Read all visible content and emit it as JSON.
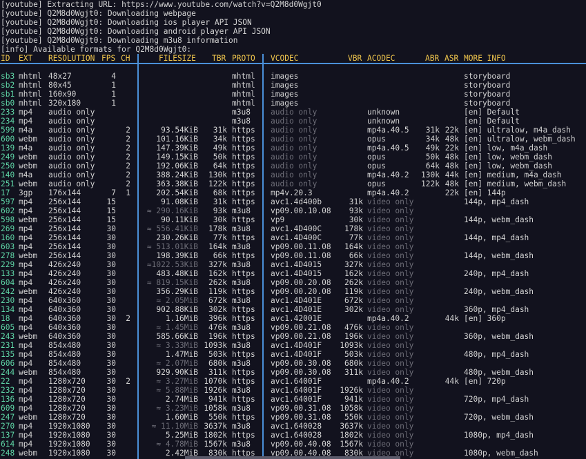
{
  "log_lines": [
    "[youtube] Extracting URL: https://www.youtube.com/watch?v=Q2M8d0Wgjt0",
    "[youtube] Q2M8d0Wgjt0: Downloading webpage",
    "[youtube] Q2M8d0Wgjt0: Downloading ios player API JSON",
    "[youtube] Q2M8d0Wgjt0: Downloading android player API JSON",
    "[youtube] Q2M8d0Wgjt0: Downloading m3u8 information",
    "[info] Available formats for Q2M8d0Wgjt0:"
  ],
  "header": {
    "id": "ID",
    "ext": "EXT",
    "res": "RESOLUTION",
    "fps": "FPS",
    "ch": "CH",
    "sep1": "│",
    "filesize": "FILESIZE",
    "tbr": "TBR",
    "proto": "PROTO",
    "sep2": "│",
    "vcodec": "VCODEC",
    "vbr": "VBR",
    "acodec": "ACODEC",
    "abr": "ABR",
    "asr": "ASR",
    "info": "MORE INFO"
  },
  "rows": [
    {
      "id": "sb3",
      "ext": "mhtml",
      "res": "48x27",
      "fps": "4",
      "ch": "",
      "fs": "",
      "tbr": "",
      "proto": "mhtml",
      "vc": "images",
      "vbr": "",
      "ac": "",
      "abr": "",
      "asr": "",
      "info": "storyboard"
    },
    {
      "id": "sb2",
      "ext": "mhtml",
      "res": "80x45",
      "fps": "1",
      "ch": "",
      "fs": "",
      "tbr": "",
      "proto": "mhtml",
      "vc": "images",
      "vbr": "",
      "ac": "",
      "abr": "",
      "asr": "",
      "info": "storyboard"
    },
    {
      "id": "sb1",
      "ext": "mhtml",
      "res": "160x90",
      "fps": "1",
      "ch": "",
      "fs": "",
      "tbr": "",
      "proto": "mhtml",
      "vc": "images",
      "vbr": "",
      "ac": "",
      "abr": "",
      "asr": "",
      "info": "storyboard"
    },
    {
      "id": "sb0",
      "ext": "mhtml",
      "res": "320x180",
      "fps": "1",
      "ch": "",
      "fs": "",
      "tbr": "",
      "proto": "mhtml",
      "vc": "images",
      "vbr": "",
      "ac": "",
      "abr": "",
      "asr": "",
      "info": "storyboard"
    },
    {
      "id": "233",
      "ext": "mp4",
      "res": "audio only",
      "fps": "",
      "ch": "",
      "fs": "",
      "tbr": "",
      "proto": "m3u8",
      "vc": "audio only",
      "vbr": "",
      "ac": "unknown",
      "abr": "",
      "asr": "",
      "info": "[en] Default"
    },
    {
      "id": "234",
      "ext": "mp4",
      "res": "audio only",
      "fps": "",
      "ch": "",
      "fs": "",
      "tbr": "",
      "proto": "m3u8",
      "vc": "audio only",
      "vbr": "",
      "ac": "unknown",
      "abr": "",
      "asr": "",
      "info": "[en] Default"
    },
    {
      "id": "599",
      "ext": "m4a",
      "res": "audio only",
      "fps": "",
      "ch": "2",
      "fs": "93.54KiB",
      "tbr": "31k",
      "proto": "https",
      "vc": "audio only",
      "vbr": "",
      "ac": "mp4a.40.5",
      "abr": "31k",
      "asr": "22k",
      "info": "[en] ultralow, m4a_dash"
    },
    {
      "id": "600",
      "ext": "webm",
      "res": "audio only",
      "fps": "",
      "ch": "2",
      "fs": "101.16KiB",
      "tbr": "34k",
      "proto": "https",
      "vc": "audio only",
      "vbr": "",
      "ac": "opus",
      "abr": "34k",
      "asr": "48k",
      "info": "[en] ultralow, webm_dash"
    },
    {
      "id": "139",
      "ext": "m4a",
      "res": "audio only",
      "fps": "",
      "ch": "2",
      "fs": "147.39KiB",
      "tbr": "49k",
      "proto": "https",
      "vc": "audio only",
      "vbr": "",
      "ac": "mp4a.40.5",
      "abr": "49k",
      "asr": "22k",
      "info": "[en] low, m4a_dash"
    },
    {
      "id": "249",
      "ext": "webm",
      "res": "audio only",
      "fps": "",
      "ch": "2",
      "fs": "149.15KiB",
      "tbr": "50k",
      "proto": "https",
      "vc": "audio only",
      "vbr": "",
      "ac": "opus",
      "abr": "50k",
      "asr": "48k",
      "info": "[en] low, webm_dash"
    },
    {
      "id": "250",
      "ext": "webm",
      "res": "audio only",
      "fps": "",
      "ch": "2",
      "fs": "192.06KiB",
      "tbr": "64k",
      "proto": "https",
      "vc": "audio only",
      "vbr": "",
      "ac": "opus",
      "abr": "64k",
      "asr": "48k",
      "info": "[en] low, webm_dash"
    },
    {
      "id": "140",
      "ext": "m4a",
      "res": "audio only",
      "fps": "",
      "ch": "2",
      "fs": "388.24KiB",
      "tbr": "130k",
      "proto": "https",
      "vc": "audio only",
      "vbr": "",
      "ac": "mp4a.40.2",
      "abr": "130k",
      "asr": "44k",
      "info": "[en] medium, m4a_dash"
    },
    {
      "id": "251",
      "ext": "webm",
      "res": "audio only",
      "fps": "",
      "ch": "2",
      "fs": "363.38KiB",
      "tbr": "122k",
      "proto": "https",
      "vc": "audio only",
      "vbr": "",
      "ac": "opus",
      "abr": "122k",
      "asr": "48k",
      "info": "[en] medium, webm_dash"
    },
    {
      "id": "17",
      "ext": "3gp",
      "res": "176x144",
      "fps": "7",
      "ch": "1",
      "fs": "202.54KiB",
      "tbr": "68k",
      "proto": "https",
      "vc": "mp4v.20.3",
      "vbr": "",
      "ac": "mp4a.40.2",
      "abr": "",
      "asr": "22k",
      "info": "[en] 144p"
    },
    {
      "id": "597",
      "ext": "mp4",
      "res": "256x144",
      "fps": "15",
      "ch": "",
      "fs": "91.08KiB",
      "tbr": "31k",
      "proto": "https",
      "vc": "avc1.4d400b",
      "vbr": "31k",
      "ac": "video only",
      "abr": "",
      "asr": "",
      "info": "144p, mp4_dash"
    },
    {
      "id": "602",
      "ext": "mp4",
      "res": "256x144",
      "fps": "15",
      "ch": "",
      "fs": "≈ 290.16KiB",
      "tbr": "93k",
      "proto": "m3u8",
      "vc": "vp09.00.10.08",
      "vbr": "93k",
      "ac": "video only",
      "abr": "",
      "asr": "",
      "info": ""
    },
    {
      "id": "598",
      "ext": "webm",
      "res": "256x144",
      "fps": "15",
      "ch": "",
      "fs": "90.11KiB",
      "tbr": "30k",
      "proto": "https",
      "vc": "vp9",
      "vbr": "30k",
      "ac": "video only",
      "abr": "",
      "asr": "",
      "info": "144p, webm_dash"
    },
    {
      "id": "269",
      "ext": "mp4",
      "res": "256x144",
      "fps": "30",
      "ch": "",
      "fs": "≈ 556.41KiB",
      "tbr": "178k",
      "proto": "m3u8",
      "vc": "avc1.4D400C",
      "vbr": "178k",
      "ac": "video only",
      "abr": "",
      "asr": "",
      "info": ""
    },
    {
      "id": "160",
      "ext": "mp4",
      "res": "256x144",
      "fps": "30",
      "ch": "",
      "fs": "230.26KiB",
      "tbr": "77k",
      "proto": "https",
      "vc": "avc1.4D400C",
      "vbr": "77k",
      "ac": "video only",
      "abr": "",
      "asr": "",
      "info": "144p, mp4_dash"
    },
    {
      "id": "603",
      "ext": "mp4",
      "res": "256x144",
      "fps": "30",
      "ch": "",
      "fs": "≈ 513.01KiB",
      "tbr": "164k",
      "proto": "m3u8",
      "vc": "vp09.00.11.08",
      "vbr": "164k",
      "ac": "video only",
      "abr": "",
      "asr": "",
      "info": ""
    },
    {
      "id": "278",
      "ext": "webm",
      "res": "256x144",
      "fps": "30",
      "ch": "",
      "fs": "198.39KiB",
      "tbr": "66k",
      "proto": "https",
      "vc": "vp09.00.11.08",
      "vbr": "66k",
      "ac": "video only",
      "abr": "",
      "asr": "",
      "info": "144p, webm_dash"
    },
    {
      "id": "229",
      "ext": "mp4",
      "res": "426x240",
      "fps": "30",
      "ch": "",
      "fs": "≈1022.53KiB",
      "tbr": "327k",
      "proto": "m3u8",
      "vc": "avc1.4D4015",
      "vbr": "327k",
      "ac": "video only",
      "abr": "",
      "asr": "",
      "info": ""
    },
    {
      "id": "133",
      "ext": "mp4",
      "res": "426x240",
      "fps": "30",
      "ch": "",
      "fs": "483.48KiB",
      "tbr": "162k",
      "proto": "https",
      "vc": "avc1.4D4015",
      "vbr": "162k",
      "ac": "video only",
      "abr": "",
      "asr": "",
      "info": "240p, mp4_dash"
    },
    {
      "id": "604",
      "ext": "mp4",
      "res": "426x240",
      "fps": "30",
      "ch": "",
      "fs": "≈ 819.15KiB",
      "tbr": "262k",
      "proto": "m3u8",
      "vc": "vp09.00.20.08",
      "vbr": "262k",
      "ac": "video only",
      "abr": "",
      "asr": "",
      "info": ""
    },
    {
      "id": "242",
      "ext": "webm",
      "res": "426x240",
      "fps": "30",
      "ch": "",
      "fs": "356.29KiB",
      "tbr": "119k",
      "proto": "https",
      "vc": "vp09.00.20.08",
      "vbr": "119k",
      "ac": "video only",
      "abr": "",
      "asr": "",
      "info": "240p, webm_dash"
    },
    {
      "id": "230",
      "ext": "mp4",
      "res": "640x360",
      "fps": "30",
      "ch": "",
      "fs": "≈ 2.05MiB",
      "tbr": "672k",
      "proto": "m3u8",
      "vc": "avc1.4D401E",
      "vbr": "672k",
      "ac": "video only",
      "abr": "",
      "asr": "",
      "info": ""
    },
    {
      "id": "134",
      "ext": "mp4",
      "res": "640x360",
      "fps": "30",
      "ch": "",
      "fs": "902.88KiB",
      "tbr": "302k",
      "proto": "https",
      "vc": "avc1.4D401E",
      "vbr": "302k",
      "ac": "video only",
      "abr": "",
      "asr": "",
      "info": "360p, mp4_dash"
    },
    {
      "id": "18",
      "ext": "mp4",
      "res": "640x360",
      "fps": "30",
      "ch": "2",
      "fs": "1.16MiB",
      "tbr": "396k",
      "proto": "https",
      "vc": "avc1.42001E",
      "vbr": "",
      "ac": "mp4a.40.2",
      "abr": "",
      "asr": "44k",
      "info": "[en] 360p"
    },
    {
      "id": "605",
      "ext": "mp4",
      "res": "640x360",
      "fps": "30",
      "ch": "",
      "fs": "≈ 1.45MiB",
      "tbr": "476k",
      "proto": "m3u8",
      "vc": "vp09.00.21.08",
      "vbr": "476k",
      "ac": "video only",
      "abr": "",
      "asr": "",
      "info": ""
    },
    {
      "id": "243",
      "ext": "webm",
      "res": "640x360",
      "fps": "30",
      "ch": "",
      "fs": "585.66KiB",
      "tbr": "196k",
      "proto": "https",
      "vc": "vp09.00.21.08",
      "vbr": "196k",
      "ac": "video only",
      "abr": "",
      "asr": "",
      "info": "360p, webm_dash"
    },
    {
      "id": "231",
      "ext": "mp4",
      "res": "854x480",
      "fps": "30",
      "ch": "",
      "fs": "≈ 3.33MiB",
      "tbr": "1093k",
      "proto": "m3u8",
      "vc": "avc1.4D401F",
      "vbr": "1093k",
      "ac": "video only",
      "abr": "",
      "asr": "",
      "info": ""
    },
    {
      "id": "135",
      "ext": "mp4",
      "res": "854x480",
      "fps": "30",
      "ch": "",
      "fs": "1.47MiB",
      "tbr": "503k",
      "proto": "https",
      "vc": "avc1.4D401F",
      "vbr": "503k",
      "ac": "video only",
      "abr": "",
      "asr": "",
      "info": "480p, mp4_dash"
    },
    {
      "id": "606",
      "ext": "mp4",
      "res": "854x480",
      "fps": "30",
      "ch": "",
      "fs": "≈ 2.07MiB",
      "tbr": "680k",
      "proto": "m3u8",
      "vc": "vp09.00.30.08",
      "vbr": "680k",
      "ac": "video only",
      "abr": "",
      "asr": "",
      "info": ""
    },
    {
      "id": "244",
      "ext": "webm",
      "res": "854x480",
      "fps": "30",
      "ch": "",
      "fs": "929.90KiB",
      "tbr": "311k",
      "proto": "https",
      "vc": "vp09.00.30.08",
      "vbr": "311k",
      "ac": "video only",
      "abr": "",
      "asr": "",
      "info": "480p, webm_dash"
    },
    {
      "id": "22",
      "ext": "mp4",
      "res": "1280x720",
      "fps": "30",
      "ch": "2",
      "fs": "≈ 3.27MiB",
      "tbr": "1070k",
      "proto": "https",
      "vc": "avc1.64001F",
      "vbr": "",
      "ac": "mp4a.40.2",
      "abr": "",
      "asr": "44k",
      "info": "[en] 720p"
    },
    {
      "id": "232",
      "ext": "mp4",
      "res": "1280x720",
      "fps": "30",
      "ch": "",
      "fs": "≈ 5.88MiB",
      "tbr": "1926k",
      "proto": "m3u8",
      "vc": "avc1.64001F",
      "vbr": "1926k",
      "ac": "video only",
      "abr": "",
      "asr": "",
      "info": ""
    },
    {
      "id": "136",
      "ext": "mp4",
      "res": "1280x720",
      "fps": "30",
      "ch": "",
      "fs": "2.74MiB",
      "tbr": "941k",
      "proto": "https",
      "vc": "avc1.64001F",
      "vbr": "941k",
      "ac": "video only",
      "abr": "",
      "asr": "",
      "info": "720p, mp4_dash"
    },
    {
      "id": "609",
      "ext": "mp4",
      "res": "1280x720",
      "fps": "30",
      "ch": "",
      "fs": "≈ 3.23MiB",
      "tbr": "1058k",
      "proto": "m3u8",
      "vc": "vp09.00.31.08",
      "vbr": "1058k",
      "ac": "video only",
      "abr": "",
      "asr": "",
      "info": ""
    },
    {
      "id": "247",
      "ext": "webm",
      "res": "1280x720",
      "fps": "30",
      "ch": "",
      "fs": "1.60MiB",
      "tbr": "550k",
      "proto": "https",
      "vc": "vp09.00.31.08",
      "vbr": "550k",
      "ac": "video only",
      "abr": "",
      "asr": "",
      "info": "720p, webm_dash"
    },
    {
      "id": "270",
      "ext": "mp4",
      "res": "1920x1080",
      "fps": "30",
      "ch": "",
      "fs": "≈ 11.10MiB",
      "tbr": "3637k",
      "proto": "m3u8",
      "vc": "avc1.640028",
      "vbr": "3637k",
      "ac": "video only",
      "abr": "",
      "asr": "",
      "info": ""
    },
    {
      "id": "137",
      "ext": "mp4",
      "res": "1920x1080",
      "fps": "30",
      "ch": "",
      "fs": "5.25MiB",
      "tbr": "1802k",
      "proto": "https",
      "vc": "avc1.640028",
      "vbr": "1802k",
      "ac": "video only",
      "abr": "",
      "asr": "",
      "info": "1080p, mp4_dash"
    },
    {
      "id": "614",
      "ext": "mp4",
      "res": "1920x1080",
      "fps": "30",
      "ch": "",
      "fs": "≈ 4.78MiB",
      "tbr": "1567k",
      "proto": "m3u8",
      "vc": "vp09.00.40.08",
      "vbr": "1567k",
      "ac": "video only",
      "abr": "",
      "asr": "",
      "info": ""
    },
    {
      "id": "248",
      "ext": "webm",
      "res": "1920x1080",
      "fps": "30",
      "ch": "",
      "fs": "2.42MiB",
      "tbr": "830k",
      "proto": "https",
      "vc": "vp09.00.40.08",
      "vbr": "830k",
      "ac": "video only",
      "abr": "",
      "asr": "",
      "info": "1080p, webm_dash"
    }
  ],
  "colors": {
    "background": "#12121e",
    "text": "#d3d3d3",
    "id": "#5fd7a7",
    "header": "#f0c64d",
    "separator": "#4a90d9",
    "dim": "#6e6e78"
  }
}
